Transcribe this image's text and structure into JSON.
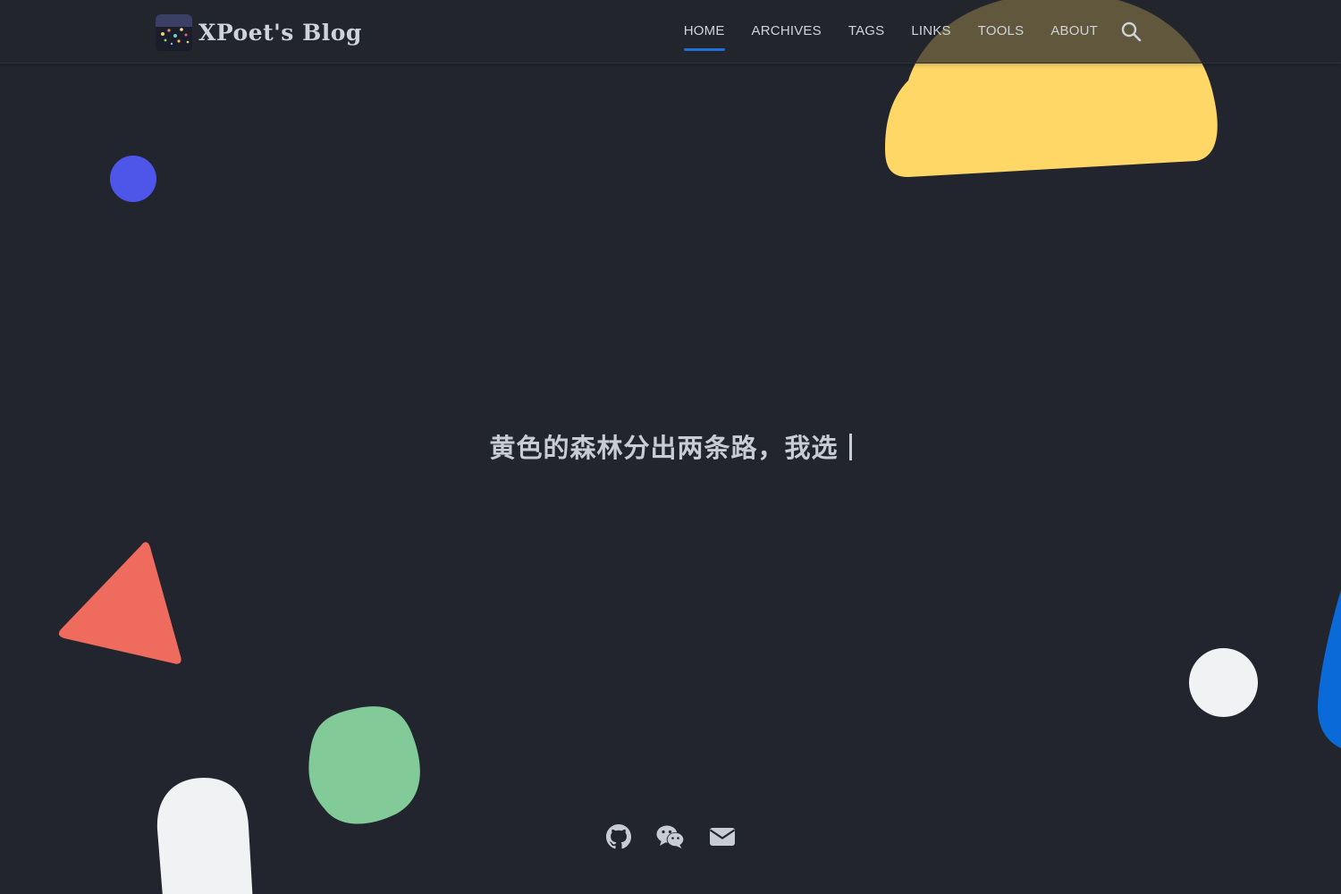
{
  "header": {
    "title": "XPoet's Blog",
    "logo_icon": "city-lights-avatar",
    "nav": [
      {
        "label": "HOME",
        "active": true
      },
      {
        "label": "ARCHIVES",
        "active": false
      },
      {
        "label": "TAGS",
        "active": false
      },
      {
        "label": "LINKS",
        "active": false
      },
      {
        "label": "TOOLS",
        "active": false
      },
      {
        "label": "ABOUT",
        "active": false
      }
    ],
    "search_icon": "search-icon"
  },
  "hero": {
    "text": "黄色的森林分出两条路，我选"
  },
  "social": [
    {
      "icon": "github-icon"
    },
    {
      "icon": "wechat-icon"
    },
    {
      "icon": "email-icon"
    }
  ],
  "colors": {
    "background": "#22252d",
    "text": "#c8ccd3",
    "accent": "#1f6fd6",
    "yellow": "#fed766",
    "blue": "#4e55e9",
    "red": "#ee6b5d",
    "green": "#82ca98",
    "white": "#f1f2f4",
    "edge_blue": "#0a6bd8"
  }
}
